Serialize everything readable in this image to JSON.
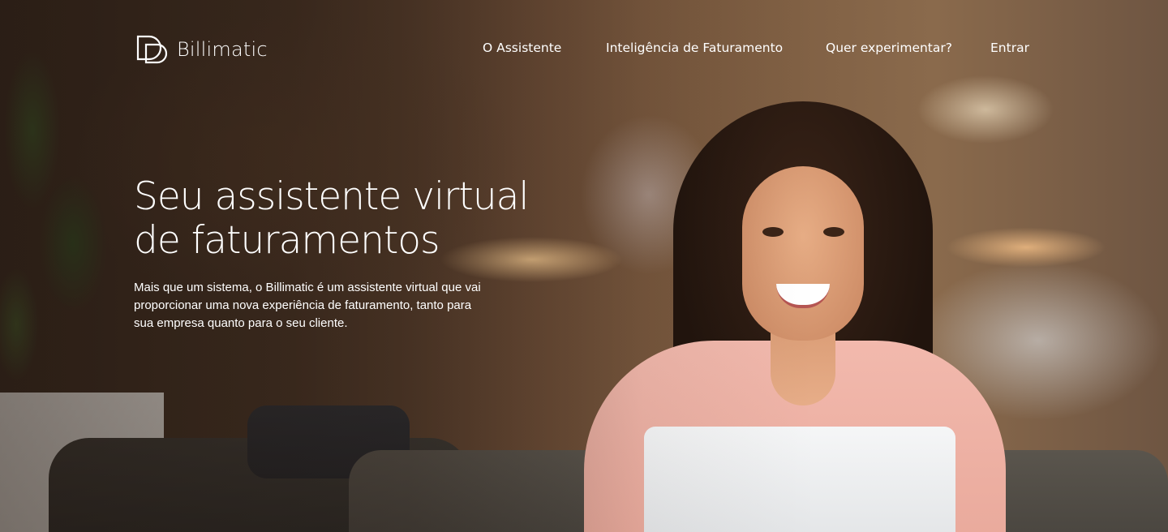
{
  "brand": {
    "name": "Billimatic",
    "logo_icon": "billimatic-logo-icon"
  },
  "nav": {
    "items": [
      {
        "label": "O Assistente"
      },
      {
        "label": "Inteligência de Faturamento"
      },
      {
        "label": "Quer experimentar?"
      },
      {
        "label": "Entrar"
      }
    ]
  },
  "hero": {
    "headline_line1": "Seu assistente virtual",
    "headline_line2": "de faturamentos",
    "description": "Mais que um sistema, o Billimatic é um assistente virtual que vai proporcionar uma nova experiência de faturamento, tanto para sua empresa quanto para o seu cliente."
  },
  "colors": {
    "text": "#ffffff",
    "accent_pink": "#f2b9ad",
    "wood": "#6b4c36"
  }
}
